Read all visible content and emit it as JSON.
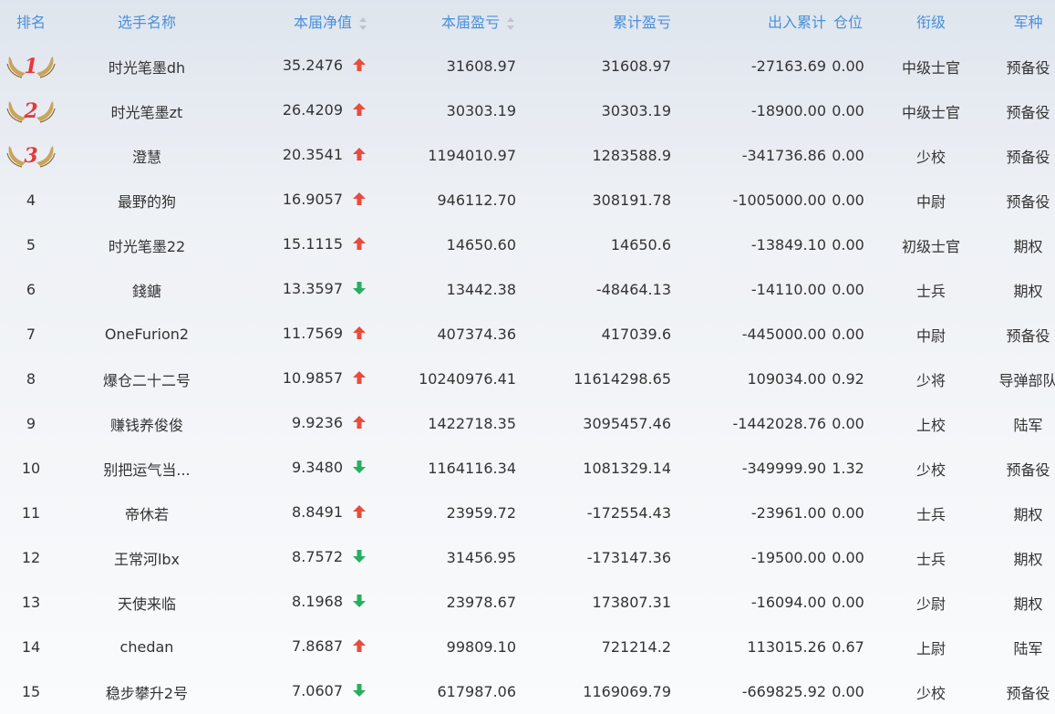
{
  "colors": {
    "header_text": "#4a90d9",
    "up": "#e74c3c",
    "down": "#27ae60",
    "medal_wing": "#b88a3e",
    "medal_number": "#e43a3a"
  },
  "header": {
    "rank": "排名",
    "name": "选手名称",
    "nav": "本届净值",
    "pnl": "本届盈亏",
    "cum": "累计盈亏",
    "flow": "出入累计",
    "pos": "仓位",
    "level": "衔级",
    "arm": "军种"
  },
  "icons": {
    "sort": "sort-caret-icon",
    "up": "arrow-up-icon",
    "down": "arrow-down-icon",
    "medal": "winged-medal-icon"
  },
  "rows": [
    {
      "rank": "1",
      "name": "时光笔墨dh",
      "nav": "35.2476",
      "trend": "up",
      "pnl": "31608.97",
      "cum": "31608.97",
      "flow": "-27163.69",
      "pos": "0.00",
      "level": "中级士官",
      "arm": "预备役"
    },
    {
      "rank": "2",
      "name": "时光笔墨zt",
      "nav": "26.4209",
      "trend": "up",
      "pnl": "30303.19",
      "cum": "30303.19",
      "flow": "-18900.00",
      "pos": "0.00",
      "level": "中级士官",
      "arm": "预备役"
    },
    {
      "rank": "3",
      "name": "澄慧",
      "nav": "20.3541",
      "trend": "up",
      "pnl": "1194010.97",
      "cum": "1283588.9",
      "flow": "-341736.86",
      "pos": "0.00",
      "level": "少校",
      "arm": "预备役"
    },
    {
      "rank": "4",
      "name": "最野的狗",
      "nav": "16.9057",
      "trend": "up",
      "pnl": "946112.70",
      "cum": "308191.78",
      "flow": "-1005000.00",
      "pos": "0.00",
      "level": "中尉",
      "arm": "预备役"
    },
    {
      "rank": "5",
      "name": "时光笔墨22",
      "nav": "15.1115",
      "trend": "up",
      "pnl": "14650.60",
      "cum": "14650.6",
      "flow": "-13849.10",
      "pos": "0.00",
      "level": "初级士官",
      "arm": "期权"
    },
    {
      "rank": "6",
      "name": "錢鎕",
      "nav": "13.3597",
      "trend": "down",
      "pnl": "13442.38",
      "cum": "-48464.13",
      "flow": "-14110.00",
      "pos": "0.00",
      "level": "士兵",
      "arm": "期权"
    },
    {
      "rank": "7",
      "name": "OneFurion2",
      "nav": "11.7569",
      "trend": "up",
      "pnl": "407374.36",
      "cum": "417039.6",
      "flow": "-445000.00",
      "pos": "0.00",
      "level": "中尉",
      "arm": "预备役"
    },
    {
      "rank": "8",
      "name": "爆仓二十二号",
      "nav": "10.9857",
      "trend": "up",
      "pnl": "10240976.41",
      "cum": "11614298.65",
      "flow": "109034.00",
      "pos": "0.92",
      "level": "少将",
      "arm": "导弹部队"
    },
    {
      "rank": "9",
      "name": "赚钱养俊俊",
      "nav": "9.9236",
      "trend": "up",
      "pnl": "1422718.35",
      "cum": "3095457.46",
      "flow": "-1442028.76",
      "pos": "0.00",
      "level": "上校",
      "arm": "陆军"
    },
    {
      "rank": "10",
      "name": "别把运气当...",
      "nav": "9.3480",
      "trend": "down",
      "pnl": "1164116.34",
      "cum": "1081329.14",
      "flow": "-349999.90",
      "pos": "1.32",
      "level": "少校",
      "arm": "预备役"
    },
    {
      "rank": "11",
      "name": "帝休若",
      "nav": "8.8491",
      "trend": "up",
      "pnl": "23959.72",
      "cum": "-172554.43",
      "flow": "-23961.00",
      "pos": "0.00",
      "level": "士兵",
      "arm": "期权"
    },
    {
      "rank": "12",
      "name": "王常河lbx",
      "nav": "8.7572",
      "trend": "down",
      "pnl": "31456.95",
      "cum": "-173147.36",
      "flow": "-19500.00",
      "pos": "0.00",
      "level": "士兵",
      "arm": "期权"
    },
    {
      "rank": "13",
      "name": "天使来临",
      "nav": "8.1968",
      "trend": "down",
      "pnl": "23978.67",
      "cum": "173807.31",
      "flow": "-16094.00",
      "pos": "0.00",
      "level": "少尉",
      "arm": "期权"
    },
    {
      "rank": "14",
      "name": "chedan",
      "nav": "7.8687",
      "trend": "up",
      "pnl": "99809.10",
      "cum": "721214.2",
      "flow": "113015.26",
      "pos": "0.67",
      "level": "上尉",
      "arm": "陆军"
    },
    {
      "rank": "15",
      "name": "稳步攀升2号",
      "nav": "7.0607",
      "trend": "down",
      "pnl": "617987.06",
      "cum": "1169069.79",
      "flow": "-669825.92",
      "pos": "0.00",
      "level": "少校",
      "arm": "预备役"
    }
  ]
}
